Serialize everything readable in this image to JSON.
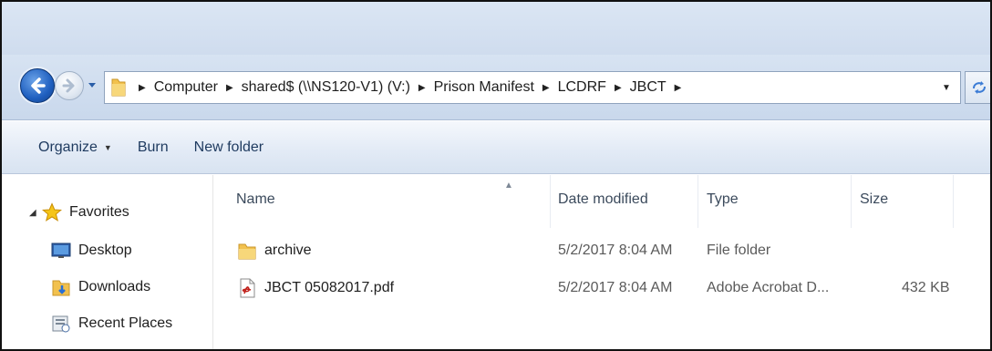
{
  "address": {
    "breadcrumbs": [
      "Computer",
      "shared$ (\\\\NS120-V1) (V:)",
      "Prison Manifest",
      "LCDRF",
      "JBCT"
    ]
  },
  "toolbar": {
    "organize_label": "Organize",
    "burn_label": "Burn",
    "new_folder_label": "New folder"
  },
  "nav": {
    "favorites_label": "Favorites",
    "items": [
      {
        "label": "Desktop",
        "icon": "desktop-icon"
      },
      {
        "label": "Downloads",
        "icon": "downloads-folder-icon"
      },
      {
        "label": "Recent Places",
        "icon": "recent-places-icon"
      }
    ]
  },
  "columns": {
    "name": "Name",
    "date_modified": "Date modified",
    "type": "Type",
    "size": "Size"
  },
  "files": [
    {
      "name": "archive",
      "date": "5/2/2017 8:04 AM",
      "type": "File folder",
      "size": "",
      "icon": "folder-icon"
    },
    {
      "name": "JBCT 05082017.pdf",
      "date": "5/2/2017 8:04 AM",
      "type": "Adobe Acrobat D...",
      "size": "432 KB",
      "icon": "pdf-icon"
    }
  ],
  "colors": {
    "accent": "#1f5fbf",
    "folder": "#f2c14e",
    "toolbar_text": "#1e3a5f"
  }
}
